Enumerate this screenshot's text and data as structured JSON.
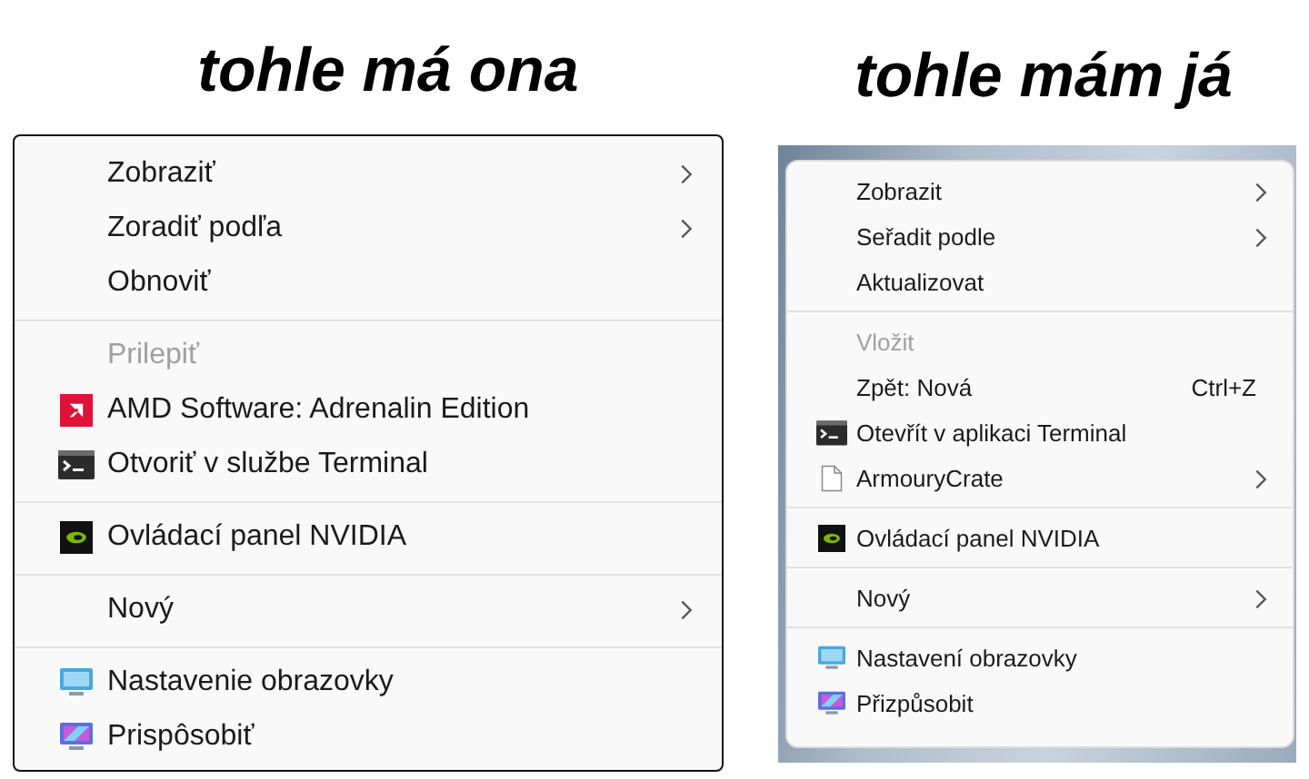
{
  "panels": [
    {
      "caption": "tohle má ona",
      "items": [
        {
          "kind": "item",
          "label": "Zobraziť",
          "submenu": true,
          "disabled": false
        },
        {
          "kind": "item",
          "label": "Zoradiť podľa",
          "submenu": true,
          "disabled": false
        },
        {
          "kind": "item",
          "label": "Obnoviť",
          "submenu": false,
          "disabled": false
        },
        {
          "kind": "separator"
        },
        {
          "kind": "item",
          "label": "Prilepiť",
          "submenu": false,
          "disabled": true
        },
        {
          "kind": "amd",
          "label": "AMD Software: Adrenalin Edition",
          "submenu": false,
          "disabled": false
        },
        {
          "kind": "terminal",
          "label": "Otvoriť v službe Terminal",
          "submenu": false,
          "disabled": false
        },
        {
          "kind": "separator"
        },
        {
          "kind": "nvidia",
          "label": "Ovládací panel NVIDIA",
          "submenu": false,
          "disabled": false
        },
        {
          "kind": "separator"
        },
        {
          "kind": "item",
          "label": "Nový",
          "submenu": true,
          "disabled": false
        },
        {
          "kind": "separator"
        },
        {
          "kind": "display",
          "label": "Nastavenie obrazovky",
          "submenu": false,
          "disabled": false
        },
        {
          "kind": "personalize",
          "label": "Prispôsobiť",
          "submenu": false,
          "disabled": false
        }
      ]
    },
    {
      "caption": "tohle mám já",
      "items": [
        {
          "kind": "item",
          "label": "Zobrazit",
          "submenu": true,
          "disabled": false
        },
        {
          "kind": "item",
          "label": "Seřadit podle",
          "submenu": true,
          "disabled": false
        },
        {
          "kind": "item",
          "label": "Aktualizovat",
          "submenu": false,
          "disabled": false
        },
        {
          "kind": "separator"
        },
        {
          "kind": "item",
          "label": "Vložit",
          "submenu": false,
          "disabled": true
        },
        {
          "kind": "item",
          "label": "Zpět: Nová",
          "shortcut": "Ctrl+Z",
          "submenu": false,
          "disabled": false
        },
        {
          "kind": "terminal",
          "label": "Otevřít v aplikaci Terminal",
          "submenu": false,
          "disabled": false
        },
        {
          "kind": "file",
          "label": "ArmouryCrate",
          "submenu": true,
          "disabled": false
        },
        {
          "kind": "separator"
        },
        {
          "kind": "nvidia",
          "label": "Ovládací panel NVIDIA",
          "submenu": false,
          "disabled": false
        },
        {
          "kind": "separator"
        },
        {
          "kind": "item",
          "label": "Nový",
          "submenu": true,
          "disabled": false
        },
        {
          "kind": "separator"
        },
        {
          "kind": "display",
          "label": "Nastavení obrazovky",
          "submenu": false,
          "disabled": false
        },
        {
          "kind": "personalize",
          "label": "Přizpůsobit",
          "submenu": false,
          "disabled": false
        }
      ]
    }
  ]
}
